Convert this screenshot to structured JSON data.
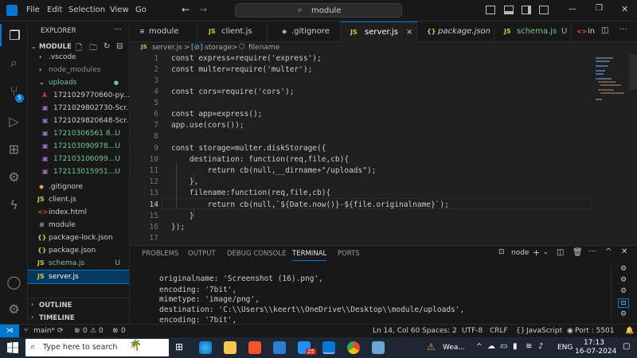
{
  "menu": [
    "File",
    "Edit",
    "Selection",
    "View",
    "Go"
  ],
  "search": {
    "text": "module"
  },
  "window_controls": [
    "—",
    "❐",
    "✕"
  ],
  "sidebar": {
    "title": "EXPLORER",
    "root": "MODULE",
    "items": [
      {
        "label": ".vscode",
        "icon": "folder",
        "status": ""
      },
      {
        "label": "node_modules",
        "icon": "folder",
        "status": ""
      },
      {
        "label": "uploads",
        "icon": "folder-open",
        "status": "●"
      },
      {
        "label": "1721029770660-py...",
        "icon": "pdf",
        "status": ""
      },
      {
        "label": "1721029802730-Scr...",
        "icon": "image",
        "status": ""
      },
      {
        "label": "1721029820648-Scr...",
        "icon": "image",
        "status": ""
      },
      {
        "label": "17210306561 8...",
        "icon": "image",
        "status": "U"
      },
      {
        "label": "172103090978...",
        "icon": "image",
        "status": "U"
      },
      {
        "label": "172103106099...",
        "icon": "image",
        "status": "U"
      },
      {
        "label": "172113015951...",
        "icon": "image",
        "status": "U"
      },
      {
        "label": ".gitignore",
        "icon": "git",
        "status": ""
      },
      {
        "label": "client.js",
        "icon": "js",
        "status": ""
      },
      {
        "label": "index.html",
        "icon": "html",
        "status": ""
      },
      {
        "label": "module",
        "icon": "file",
        "status": ""
      },
      {
        "label": "package-lock.json",
        "icon": "json",
        "status": ""
      },
      {
        "label": "package.json",
        "icon": "json",
        "status": ""
      },
      {
        "label": "schema.js",
        "icon": "js",
        "status": "U"
      },
      {
        "label": "server.js",
        "icon": "js",
        "status": ""
      }
    ],
    "outline": "OUTLINE",
    "timeline": "TIMELINE"
  },
  "tabs": [
    {
      "label": "module",
      "icon": "≡",
      "status": ""
    },
    {
      "label": "client.js",
      "icon": "JS",
      "status": ""
    },
    {
      "label": ".gitignore",
      "icon": "◆",
      "status": ""
    },
    {
      "label": "server.js",
      "icon": "JS",
      "status": "×"
    },
    {
      "label": "package.json",
      "icon": "{}",
      "status": ""
    },
    {
      "label": "schema.js",
      "icon": "JS",
      "status": "U"
    },
    {
      "label": "in",
      "icon": "<>",
      "status": ""
    }
  ],
  "breadcrumb": {
    "file": "server.js",
    "sep1": ">",
    "sym1": "storage",
    "sep2": ">",
    "sym2": "filename"
  },
  "code_lines": [
    {
      "n": "1",
      "text": "const express=require('express');"
    },
    {
      "n": "2",
      "text": "const multer=require('multer');"
    },
    {
      "n": "3",
      "text": ""
    },
    {
      "n": "4",
      "text": "const cors=require('cors');"
    },
    {
      "n": "5",
      "text": ""
    },
    {
      "n": "6",
      "text": "const app=express();"
    },
    {
      "n": "7",
      "text": "app.use(cors());"
    },
    {
      "n": "8",
      "text": ""
    },
    {
      "n": "9",
      "text": "const storage=multer.diskStorage({"
    },
    {
      "n": "10",
      "text": "    destination: function(req,file,cb){"
    },
    {
      "n": "11",
      "text": "        return cb(null,__dirname+\"/uploads\");"
    },
    {
      "n": "12",
      "text": "    },"
    },
    {
      "n": "13",
      "text": "    filename:function(req,file,cb){"
    },
    {
      "n": "14",
      "text": "        return cb(null,`${Date.now()}-${file.originalname}`);"
    },
    {
      "n": "15",
      "text": "    }"
    },
    {
      "n": "16",
      "text": "});"
    },
    {
      "n": "17",
      "text": ""
    }
  ],
  "panel": {
    "tabs": [
      "PROBLEMS",
      "OUTPUT",
      "DEBUG CONSOLE",
      "TERMINAL",
      "PORTS"
    ],
    "active_tab": "TERMINAL",
    "shell": "node",
    "terminal_lines": [
      "originalname: 'Screenshot (16).png',",
      "encoding: '7bit',",
      "mimetype: 'image/png',",
      "destination: 'C:\\\\Users\\\\keert\\\\OneDrive\\\\Desktop\\\\module/uploads',",
      "encoding: '7bit',"
    ]
  },
  "status": {
    "branch": "main*",
    "errors": "0",
    "warnings": "0",
    "ports_count": "0",
    "position": "Ln 14, Col 60",
    "spaces": "Spaces: 2",
    "encoding": "UTF-8",
    "eol": "CRLF",
    "language": "JavaScript",
    "port": "Port : 5501"
  },
  "taskbar": {
    "search_placeholder": "Type here to search",
    "weather": "Wea...",
    "lang": "ENG",
    "time": "17:13",
    "date": "16-07-2024",
    "badge": "25"
  },
  "colors": {
    "accent": "#0078d4",
    "untracked": "#73c991",
    "js": "#cbcb41"
  }
}
